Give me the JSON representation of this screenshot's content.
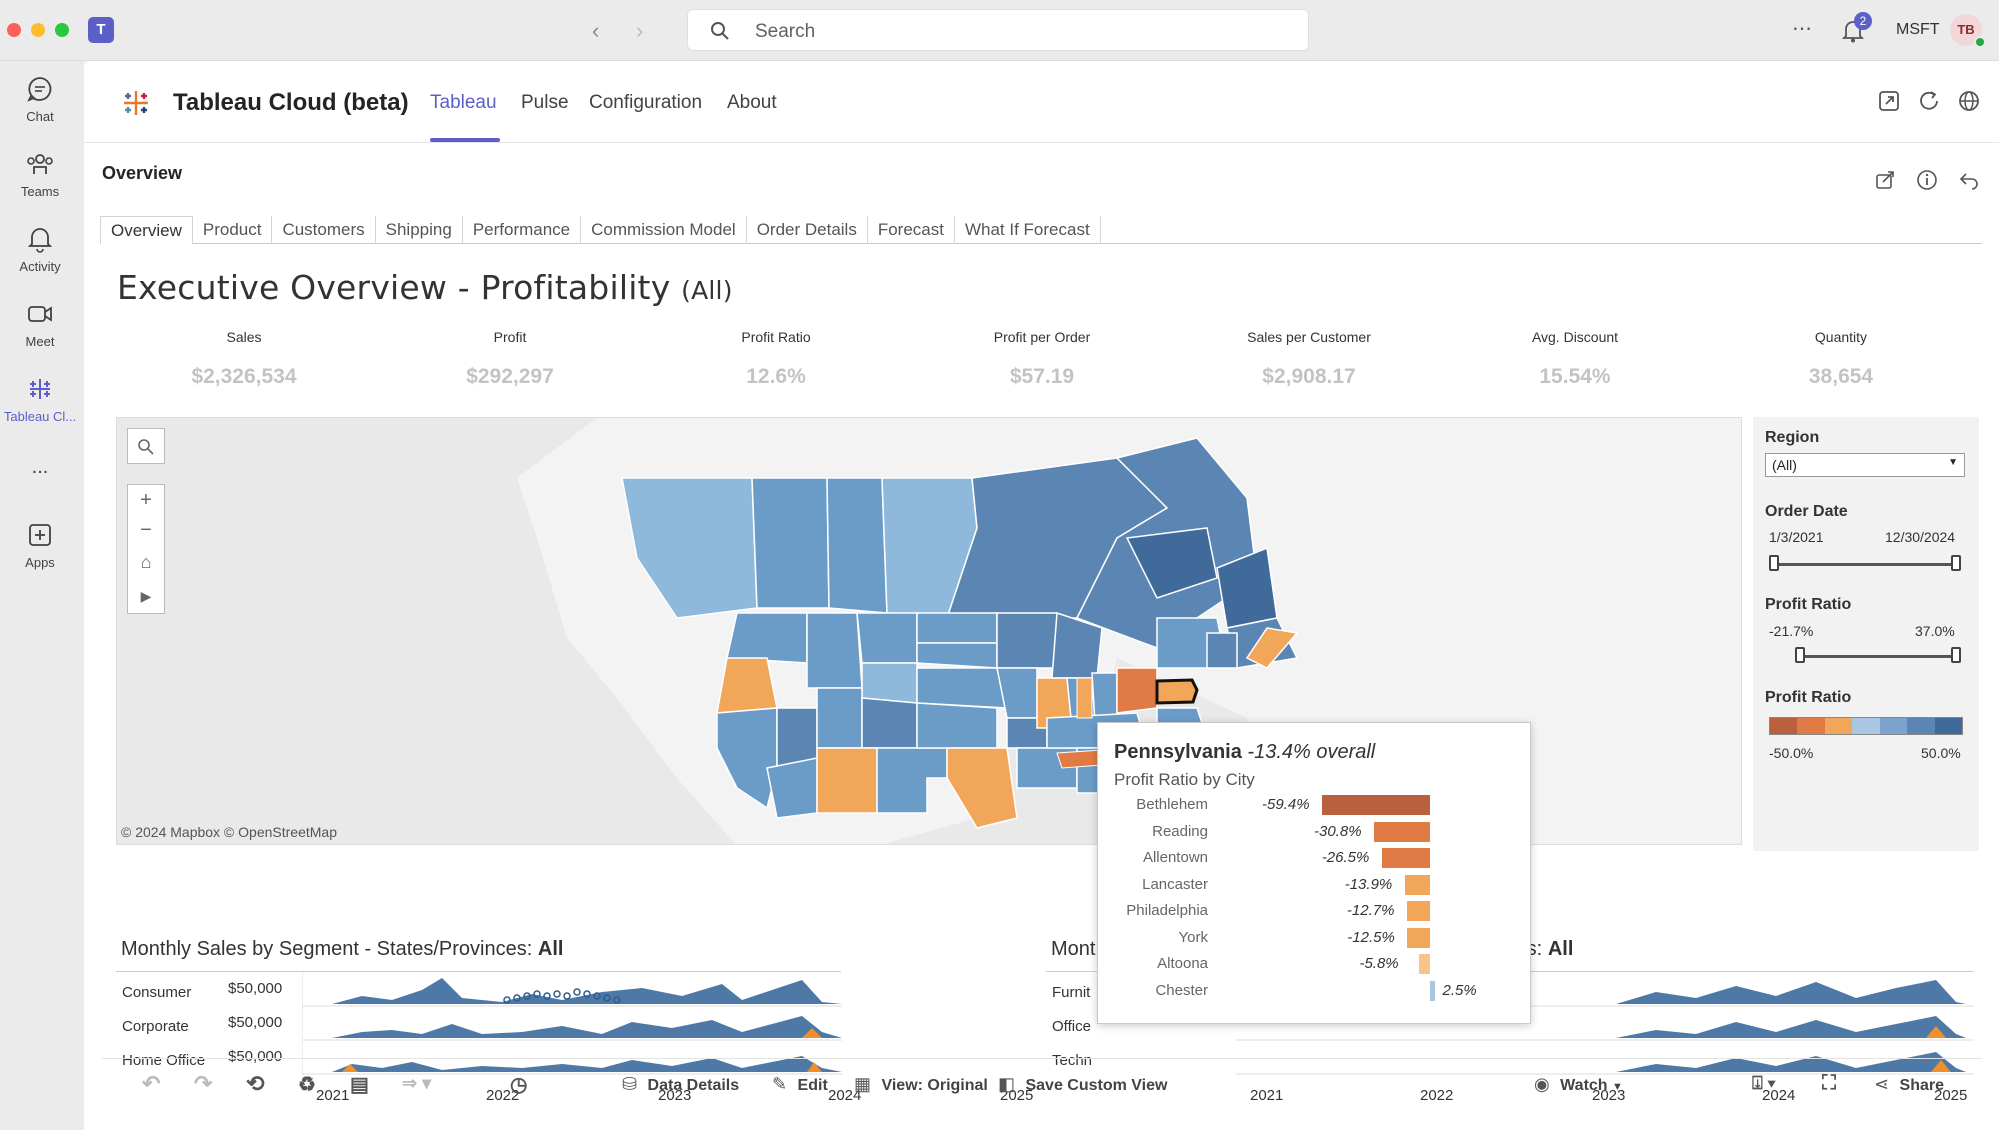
{
  "window": {
    "search_placeholder": "Search",
    "notification_count": "2",
    "org": "MSFT",
    "avatar_initials": "TB"
  },
  "rail": {
    "items": [
      {
        "label": "Chat",
        "icon": "chat-icon"
      },
      {
        "label": "Teams",
        "icon": "teams-icon"
      },
      {
        "label": "Activity",
        "icon": "bell-icon"
      },
      {
        "label": "Meet",
        "icon": "video-icon"
      },
      {
        "label": "Tableau Cl...",
        "icon": "tableau-icon"
      },
      {
        "label": "...",
        "icon": "more-icon"
      },
      {
        "label": "Apps",
        "icon": "add-app-icon"
      }
    ]
  },
  "app": {
    "title": "Tableau Cloud (beta)",
    "tabs": [
      "Tableau",
      "Pulse",
      "Configuration",
      "About"
    ],
    "active_tab": "Tableau",
    "accent": "#5b5fc7"
  },
  "view": {
    "title": "Overview",
    "dash_tabs": [
      "Overview",
      "Product",
      "Customers",
      "Shipping",
      "Performance",
      "Commission Model",
      "Order Details",
      "Forecast",
      "What If Forecast"
    ],
    "heading": "Executive Overview - Profitability",
    "heading_filter": "(All)"
  },
  "kpis": [
    {
      "label": "Sales",
      "value": "$2,326,534"
    },
    {
      "label": "Profit",
      "value": "$292,297"
    },
    {
      "label": "Profit Ratio",
      "value": "12.6%"
    },
    {
      "label": "Profit per Order",
      "value": "$57.19"
    },
    {
      "label": "Sales per Customer",
      "value": "$2,908.17"
    },
    {
      "label": "Avg. Discount",
      "value": "15.54%"
    },
    {
      "label": "Quantity",
      "value": "38,654"
    }
  ],
  "map": {
    "attribution": "© 2024 Mapbox © OpenStreetMap"
  },
  "filters": {
    "region_label": "Region",
    "region_value": "(All)",
    "order_date_label": "Order Date",
    "order_date_start": "1/3/2021",
    "order_date_end": "12/30/2024",
    "profit_ratio_label": "Profit Ratio",
    "profit_ratio_min": "-21.7%",
    "profit_ratio_max": "37.0%",
    "legend_label": "Profit Ratio",
    "legend_min": "-50.0%",
    "legend_max": "50.0%",
    "legend_colors": [
      "#b9603f",
      "#e07b45",
      "#f2a65a",
      "#a9c6e2",
      "#7ba3cc",
      "#5b86b4",
      "#3f6a99"
    ]
  },
  "segments": {
    "title": "Monthly Sales by Segment - States/Provinces:",
    "title_value": "All",
    "rows": [
      {
        "label": "Consumer",
        "axis": "$50,000"
      },
      {
        "label": "Corporate",
        "axis": "$50,000"
      },
      {
        "label": "Home Office",
        "axis": "$50,000"
      }
    ],
    "years": [
      "2021",
      "2022",
      "2023",
      "2024",
      "2025"
    ]
  },
  "categories": {
    "title_left": "Mont",
    "title_right": "tes:",
    "title_value": "All",
    "rows": [
      "Furnit",
      "Office",
      "Techn"
    ],
    "years": [
      "2021",
      "2022",
      "2023",
      "2024",
      "2025"
    ]
  },
  "tooltip": {
    "state": "Pennsylvania",
    "overall": "-13.4% overall",
    "subtitle": "Profit Ratio by City",
    "cities": [
      {
        "name": "Bethlehem",
        "pct": "-59.4%",
        "value": -59.4,
        "color": "#b9603f"
      },
      {
        "name": "Reading",
        "pct": "-30.8%",
        "value": -30.8,
        "color": "#e07b45"
      },
      {
        "name": "Allentown",
        "pct": "-26.5%",
        "value": -26.5,
        "color": "#e07b45"
      },
      {
        "name": "Lancaster",
        "pct": "-13.9%",
        "value": -13.9,
        "color": "#f2a65a"
      },
      {
        "name": "Philadelphia",
        "pct": "-12.7%",
        "value": -12.7,
        "color": "#f2a65a"
      },
      {
        "name": "York",
        "pct": "-12.5%",
        "value": -12.5,
        "color": "#f2a65a"
      },
      {
        "name": "Altoona",
        "pct": "-5.8%",
        "value": -5.8,
        "color": "#f8c489"
      },
      {
        "name": "Chester",
        "pct": "2.5%",
        "value": 2.5,
        "color": "#a9c6e2"
      }
    ]
  },
  "toolbar": {
    "data_details": "Data Details",
    "edit": "Edit",
    "view": "View: Original",
    "save_custom_view": "Save Custom View",
    "watch": "Watch",
    "share": "Share"
  }
}
